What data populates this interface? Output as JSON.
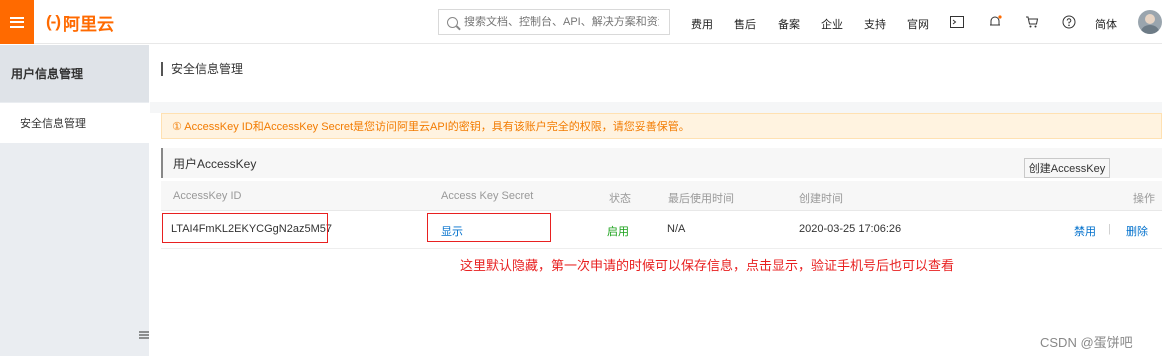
{
  "topbar": {
    "logo_text": "阿里云",
    "logo_mark": "(-)",
    "search_placeholder": "搜索文档、控制台、API、解决方案和资源",
    "nav": [
      "费用",
      "售后",
      "备案",
      "企业",
      "支持",
      "官网"
    ],
    "lang": "简体"
  },
  "sidebar": {
    "header": "用户信息管理",
    "items": [
      {
        "label": "安全信息管理"
      }
    ]
  },
  "main": {
    "title": "安全信息管理",
    "alert": "① AccessKey ID和AccessKey Secret是您访问阿里云API的密钥，具有该账户完全的权限，请您妥善保管。",
    "card_title": "用户AccessKey",
    "create_button": "创建AccessKey",
    "table": {
      "headers": [
        "AccessKey ID",
        "Access Key Secret",
        "状态",
        "最后使用时间",
        "创建时间",
        "操作"
      ],
      "row": {
        "id": "LTAI4FmKL2EKYCGgN2az5M57",
        "secret_action": "显示",
        "status": "启用",
        "last_used": "N/A",
        "created": "2020-03-25 17:06:26",
        "op_disable": "禁用",
        "op_separator": "|",
        "op_delete": "删除"
      }
    },
    "annotation": "这里默认隐藏，第一次申请的时候可以保存信息，点击显示，验证手机号后也可以查看"
  },
  "watermark": "CSDN @蛋饼吧",
  "colors": {
    "brand": "#ff6a00",
    "annotation": "#e82020",
    "status_green": "#1aa11a",
    "link": "#0070cc"
  }
}
